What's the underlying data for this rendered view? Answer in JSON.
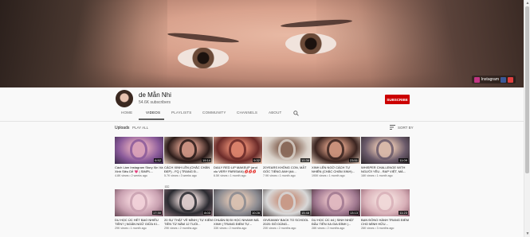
{
  "banner": {
    "social_label": "Instagram"
  },
  "channel": {
    "name": "de Mẫn Nhi",
    "subscribers": "54.6K subscribers",
    "subscribe_label": "SUBSCRIBE"
  },
  "tabs": [
    {
      "label": "HOME"
    },
    {
      "label": "VIDEOS"
    },
    {
      "label": "PLAYLISTS"
    },
    {
      "label": "COMMUNITY"
    },
    {
      "label": "CHANNELS"
    },
    {
      "label": "ABOUT"
    }
  ],
  "section": {
    "title": "Uploads",
    "play_all": "PLAY ALL",
    "sort_label": "SORT BY"
  },
  "videos": [
    {
      "title": "Cách Làm Instagram Story Xịn Và Xinh Siêu Dễ 💗 | SIMPL...",
      "meta": "4.8K views • 2 weeks ago",
      "duration": "6:52",
      "cc": "",
      "colors": [
        "#8a5a9a",
        "#d8a0b8",
        "#3a2a4a"
      ]
    },
    {
      "title": "CÁCH XINH LÊN (CHẮC CHẮN ĐẸP) - FQ | TRANG Đ...",
      "meta": "5.7K views • 3 weeks ago",
      "duration": "19:14",
      "cc": "CC",
      "colors": [
        "#2a1a18",
        "#c89080",
        "#e8d0c0"
      ]
    },
    {
      "title": "DAILY RED LIP MAKEUP (and vlo VERY PARISIAN) 💋💋💋",
      "meta": "6.5K views • 1 month ago",
      "duration": "9:32",
      "cc": "",
      "colors": [
        "#6a2a28",
        "#d8806a",
        "#f0c8b0"
      ]
    },
    {
      "title": "20YEARS KHÔNG CON, MẤT GỐC TIẾNG ANH (tôi...",
      "meta": "7.9K views • 1 month ago",
      "duration": "10:36",
      "cc": "",
      "colors": [
        "#d8d0c8",
        "#8a6a5a",
        "#f4efe8"
      ]
    },
    {
      "title": "XINH LÊN NGỜ CÁCH TỰ NHIÊN (CHẮC CHẮN XINH)...",
      "meta": "190K views • 1 month ago",
      "duration": "23:51",
      "cc": "",
      "colors": [
        "#3a2420",
        "#c8907a",
        "#f0d8c8"
      ]
    },
    {
      "title": "WHISPER CHALLENGE WITH NGƯỜI YÊU - RAP VIỆT, MÁ...",
      "meta": "16K views • 1 month ago",
      "duration": "11:09",
      "cc": "",
      "colors": [
        "#6a5a6a",
        "#d8b8a8",
        "#2a2428"
      ]
    },
    {
      "title": "DU HỌC ÚC HẾT BAO NHIÊU TIỀN? | NGÂN NGỮ GIỮA KI...",
      "meta": "29K views • 1 month ago",
      "duration": "17:30",
      "cc": "",
      "colors": [
        "#c8a0b0",
        "#f0d0d8",
        "#6a4a58"
      ]
    },
    {
      "title": "20 SỰ THẬT VỀ MÌNH | TỰ KIẾM TIỀN TỪ NĂM 12 TUỔI...",
      "meta": "29K views • 2 months ago",
      "duration": "8:03",
      "cc": "",
      "colors": [
        "#2a2a30",
        "#d8c8c8",
        "#8a7078"
      ]
    },
    {
      "title": "CHUẨN BỊ ĐI HỌC NHANH MÀ XINH | TRANG ĐIỂM TỰ...",
      "meta": "33K views • 2 months ago",
      "duration": "10:28",
      "cc": "",
      "colors": [
        "#8a8a90",
        "#d8c0b0",
        "#3a3438"
      ]
    },
    {
      "title": "GIVEAWAY BACK TO SCHOOL 2020: ĐỒ DÙNG...",
      "meta": "20K views • 2 months ago",
      "duration": "15:48",
      "cc": "",
      "colors": [
        "#d8d8d8",
        "#c89a88",
        "#4a4040"
      ]
    },
    {
      "title": "DU HỌC ÚC #4 | SINH NHẬT ĐẦU TIÊN XA GIA ĐÌNH |...",
      "meta": "28K views • 2 months ago",
      "duration": "13:13",
      "cc": "",
      "colors": [
        "#a07890",
        "#e0b8c0",
        "#402830"
      ]
    },
    {
      "title": "BẠN ĐỒNG HÀNH TRANG ĐIỂM CHO MÌNH HỮU...",
      "meta": "26K views • 3 months ago",
      "duration": "11:23",
      "cc": "",
      "colors": [
        "#d8b0b8",
        "#f0d8d8",
        "#8a5a6a"
      ]
    }
  ]
}
